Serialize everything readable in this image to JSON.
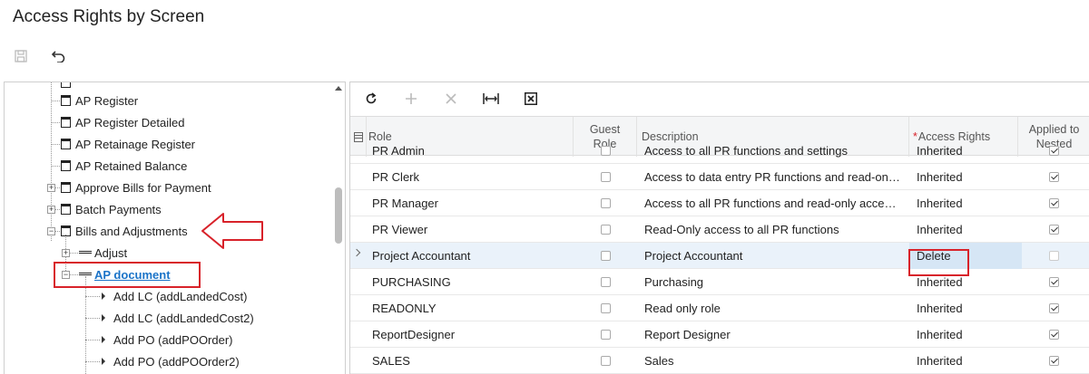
{
  "page": {
    "title": "Access Rights by Screen"
  },
  "toolbar": {
    "save_icon": "save-icon",
    "undo_icon": "undo-icon"
  },
  "tree": {
    "nodes": [
      {
        "label": "AP Register",
        "kind": "screen"
      },
      {
        "label": "AP Register Detailed",
        "kind": "screen"
      },
      {
        "label": "AP Retainage Register",
        "kind": "screen"
      },
      {
        "label": "AP Retained Balance",
        "kind": "screen"
      },
      {
        "label": "Approve Bills for Payment",
        "kind": "screen",
        "expander": "+"
      },
      {
        "label": "Batch Payments",
        "kind": "screen",
        "expander": "+"
      },
      {
        "label": "Bills and Adjustments",
        "kind": "screen",
        "expander": "−"
      },
      {
        "label": "Adjust",
        "kind": "container",
        "expander": "+"
      },
      {
        "label": "AP document",
        "kind": "container",
        "expander": "−",
        "selected": true
      },
      {
        "label": "Add LC (addLandedCost)",
        "kind": "action"
      },
      {
        "label": "Add LC (addLandedCost2)",
        "kind": "action"
      },
      {
        "label": "Add PO (addPOOrder)",
        "kind": "action"
      },
      {
        "label": "Add PO (addPOOrder2)",
        "kind": "action"
      }
    ]
  },
  "grid": {
    "toolbar": [
      "refresh-icon",
      "add-icon",
      "delete-icon",
      "fit-columns-icon",
      "excel-export-icon"
    ],
    "columns": {
      "role": "Role",
      "guest_role": "Guest Role",
      "description": "Description",
      "access_rights": "Access Rights",
      "applied_to_nested": "Applied to Nested"
    },
    "rows": [
      {
        "role": "PR Admin",
        "guest": false,
        "description": "Access to all PR functions and settings",
        "access": "Inherited",
        "nested": true
      },
      {
        "role": "PR Clerk",
        "guest": false,
        "description": "Access to data entry PR functions and read-on…",
        "access": "Inherited",
        "nested": true
      },
      {
        "role": "PR Manager",
        "guest": false,
        "description": "Access to all PR functions and read-only acce…",
        "access": "Inherited",
        "nested": true
      },
      {
        "role": "PR Viewer",
        "guest": false,
        "description": "Read-Only access to all PR functions",
        "access": "Inherited",
        "nested": true
      },
      {
        "role": "Project Accountant",
        "guest": false,
        "description": "Project Accountant",
        "access": "Delete",
        "nested": false,
        "active": true
      },
      {
        "role": "PURCHASING",
        "guest": false,
        "description": "Purchasing",
        "access": "Inherited",
        "nested": true
      },
      {
        "role": "READONLY",
        "guest": false,
        "description": "Read only role",
        "access": "Inherited",
        "nested": true
      },
      {
        "role": "ReportDesigner",
        "guest": false,
        "description": "Report Designer",
        "access": "Inherited",
        "nested": true
      },
      {
        "role": "SALES",
        "guest": false,
        "description": "Sales",
        "access": "Inherited",
        "nested": true
      }
    ]
  },
  "colors": {
    "highlight": "#d8222a",
    "link": "#1a73c8"
  }
}
